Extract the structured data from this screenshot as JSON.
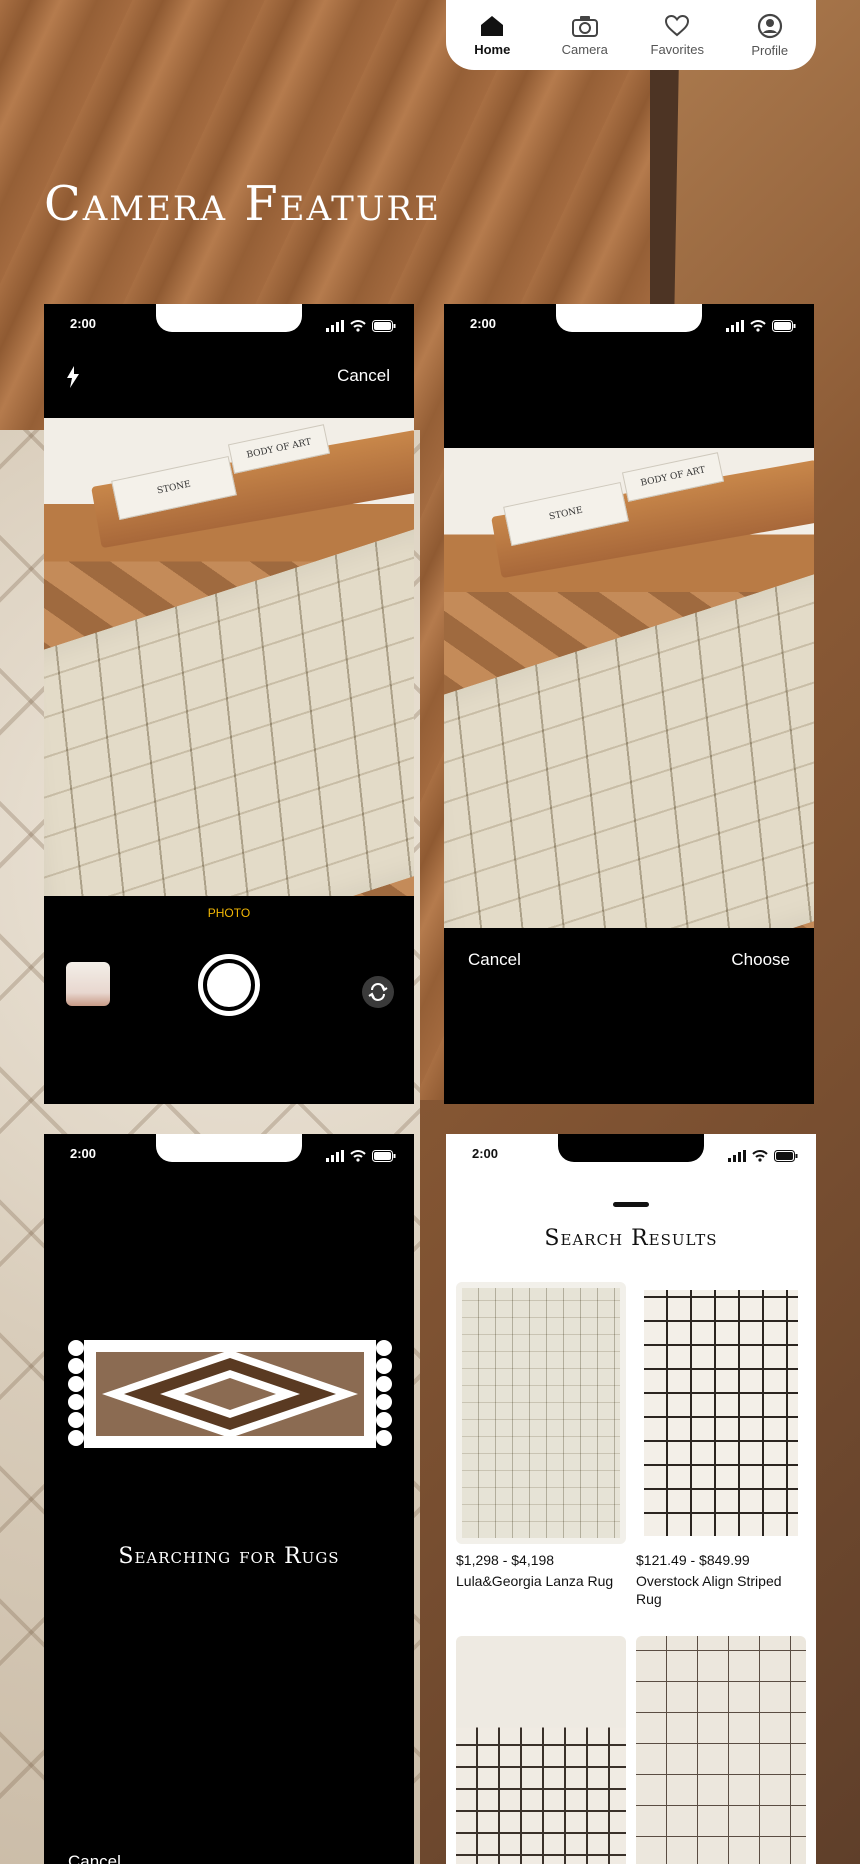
{
  "nav": {
    "items": [
      {
        "label": "Home",
        "icon": "home-icon"
      },
      {
        "label": "Camera",
        "icon": "camera-icon"
      },
      {
        "label": "Favorites",
        "icon": "heart-icon"
      },
      {
        "label": "Profile",
        "icon": "profile-icon"
      }
    ],
    "active_index": 0
  },
  "page": {
    "heading": "Camera Feature"
  },
  "screens": {
    "camera": {
      "time": "2:00",
      "cancel": "Cancel",
      "mode": "PHOTO",
      "book1": "STONE",
      "book2": "BODY OF ART"
    },
    "preview": {
      "time": "2:00",
      "cancel": "Cancel",
      "choose": "Choose",
      "book1": "STONE",
      "book2": "BODY OF ART"
    },
    "searching": {
      "time": "2:00",
      "message": "Searching for Rugs",
      "cancel": "Cancel"
    },
    "results": {
      "time": "2:00",
      "title": "Search Results",
      "products": [
        {
          "price": "$1,298 - $4,198",
          "name": "Lula&Georgia Lanza Rug"
        },
        {
          "price": "$121.49 - $849.99",
          "name": "Overstock Align Striped Rug"
        }
      ]
    }
  },
  "colors": {
    "accent_photo_label": "#f2b705",
    "rug_brown": "#8b6b52",
    "rug_light": "#ffffff"
  }
}
